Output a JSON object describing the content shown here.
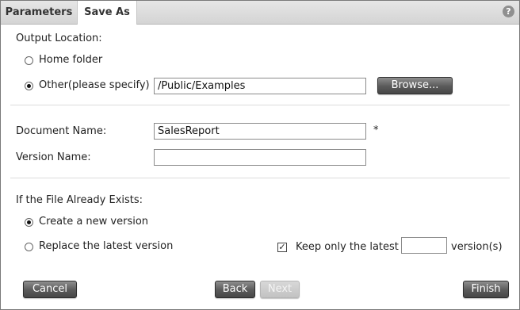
{
  "tabs": [
    {
      "label": "Parameters"
    },
    {
      "label": "Save As"
    }
  ],
  "help_icon_glyph": "?",
  "output_location": {
    "heading": "Output Location:",
    "home_folder_label": "Home folder",
    "other_label": "Other(please specify)",
    "other_path_value": "/Public/Examples",
    "browse_label": "Browse...",
    "selected": "other"
  },
  "document": {
    "name_label": "Document Name:",
    "name_value": "SalesReport",
    "required_marker": "*",
    "version_label": "Version Name:",
    "version_value": ""
  },
  "file_exists": {
    "heading": "If the File Already Exists:",
    "create_label": "Create a new version",
    "replace_label": "Replace the latest version",
    "keep_label": "Keep only the latest",
    "keep_value": "",
    "keep_suffix": "version(s)",
    "keep_checked_glyph": "✓",
    "selected": "create"
  },
  "footer": {
    "cancel_label": "Cancel",
    "back_label": "Back",
    "next_label": "Next",
    "finish_label": "Finish"
  },
  "colors": {
    "button_dark": "#5a5a5a",
    "button_disabled": "#c8c8c8",
    "border": "#7a7a7a"
  }
}
